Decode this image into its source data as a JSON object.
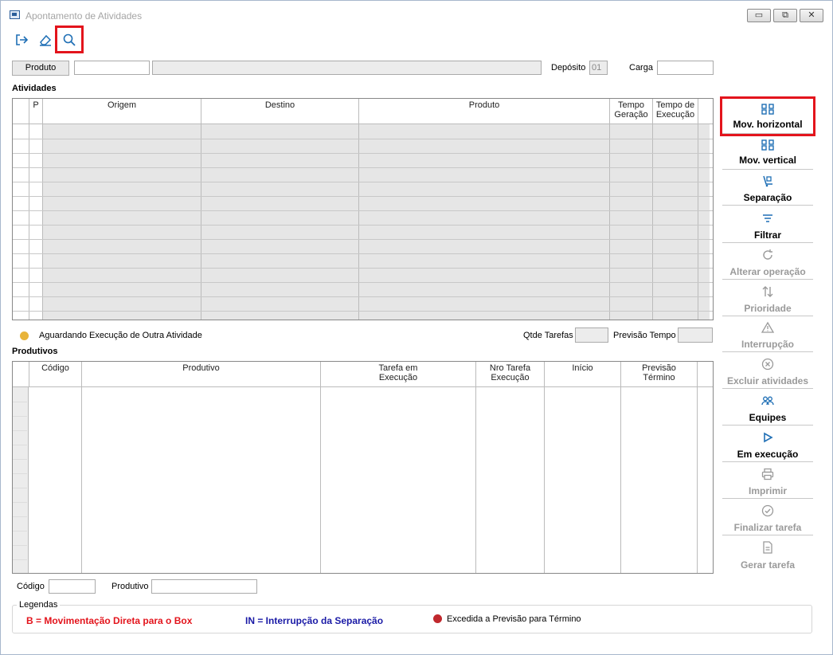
{
  "window": {
    "title": "Apontamento de Atividades",
    "minimize": "▭",
    "restore": "⧉",
    "close": "✕"
  },
  "toolbar": {
    "exit_icon": "exit-icon",
    "eraser_icon": "eraser-icon",
    "search_icon": "search-icon"
  },
  "filter": {
    "produto_button": "Produto",
    "produto_code": "",
    "produto_desc": "",
    "deposito_label": "Depósito",
    "deposito_value": "01",
    "carga_label": "Carga",
    "carga_value": ""
  },
  "atividades": {
    "title": "Atividades",
    "columns": [
      "",
      "P",
      "Origem",
      "Destino",
      "Produto",
      "Tempo Geração",
      "Tempo de Execução"
    ]
  },
  "status_legend": {
    "text": "Aguardando Execução de Outra Atividade",
    "color": "#e8b43a"
  },
  "summary": {
    "qtde_label": "Qtde Tarefas",
    "qtde_value": "",
    "previsao_label": "Previsão Tempo",
    "previsao_value": ""
  },
  "produtivos": {
    "title": "Produtivos",
    "columns": [
      "",
      "Código",
      "Produtivo",
      "Tarefa em Execução",
      "Nro Tarefa Execução",
      "Início",
      "Previsão Término"
    ]
  },
  "bottom_filter": {
    "codigo_label": "Código",
    "codigo_value": "",
    "produtivo_label": "Produtivo",
    "produtivo_value": ""
  },
  "legendas": {
    "title": "Legendas",
    "b_text": "B = Movimentação Direta para o Box",
    "b_color": "#e3141c",
    "in_text": "IN = Interrupção da Separação",
    "in_color": "#1a1aa6",
    "excedida_text": "Excedida a Previsão para Término",
    "excedida_color": "#c0282d"
  },
  "side_buttons": [
    {
      "label": "Mov. horizontal",
      "icon": "grid-move-icon",
      "enabled": true
    },
    {
      "label": "Mov. vertical",
      "icon": "grid-move-icon",
      "enabled": true
    },
    {
      "label": "Separação",
      "icon": "picking-icon",
      "enabled": true
    },
    {
      "label": "Filtrar",
      "icon": "filter-icon",
      "enabled": true
    },
    {
      "label": "Alterar operação",
      "icon": "refresh-icon",
      "enabled": false
    },
    {
      "label": "Prioridade",
      "icon": "sort-arrows-icon",
      "enabled": false
    },
    {
      "label": "Interrupção",
      "icon": "warning-icon",
      "enabled": false
    },
    {
      "label": "Excluir atividades",
      "icon": "delete-circle-icon",
      "enabled": false
    },
    {
      "label": "Equipes",
      "icon": "team-icon",
      "enabled": true
    },
    {
      "label": "Em execução",
      "icon": "play-icon",
      "enabled": true
    },
    {
      "label": "Imprimir",
      "icon": "printer-icon",
      "enabled": false
    },
    {
      "label": "Finalizar tarefa",
      "icon": "check-circle-icon",
      "enabled": false
    },
    {
      "label": "Gerar tarefa",
      "icon": "document-icon",
      "enabled": false
    }
  ],
  "colors": {
    "accent_blue": "#1f6fb5",
    "disabled": "#9a9a9a",
    "highlight": "#e3141c"
  }
}
